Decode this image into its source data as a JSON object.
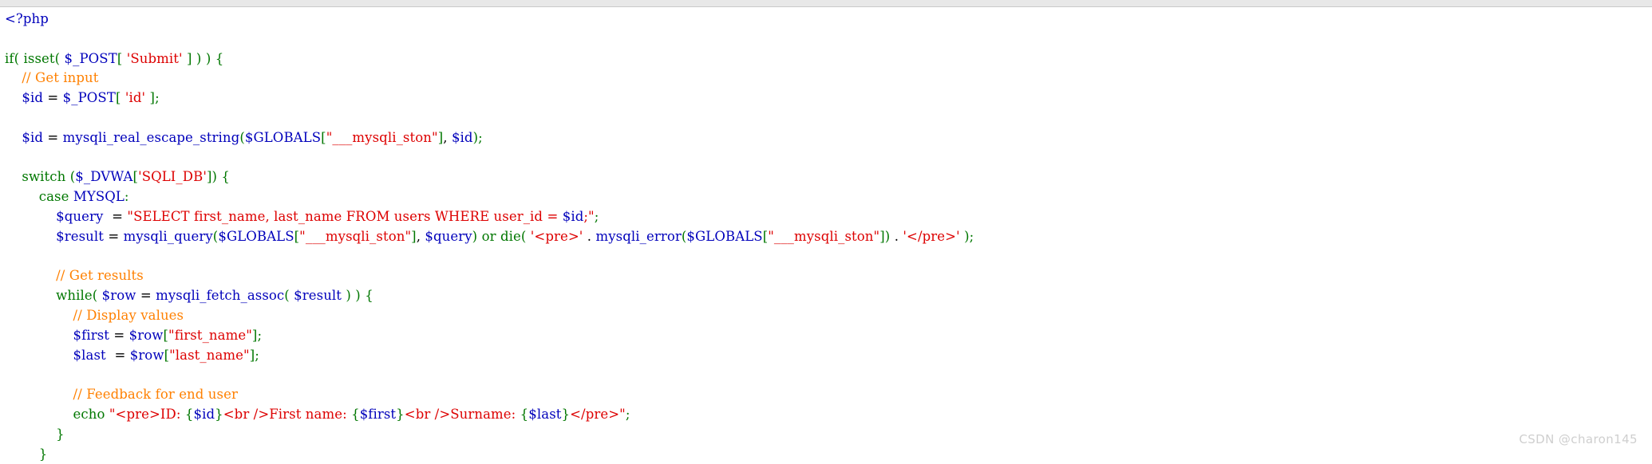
{
  "watermark": {
    "text": "CSDN @charon145",
    "color": "#cfcfcf"
  },
  "colors": {
    "background": "#ffffff",
    "top_rule": "#e8e8e8",
    "tag": "#0000bb",
    "keyword": "#007700",
    "variable": "#0000bb",
    "function": "#0000bb",
    "string": "#dd0000",
    "comment": "#ff8000",
    "punctuation": "#007700",
    "plain": "#000000"
  },
  "code": {
    "language": "php",
    "lines": [
      {
        "index": 0,
        "text": "<?php",
        "tokens": [
          {
            "t": "<?php",
            "c": "tok-tag"
          }
        ]
      },
      {
        "index": 1,
        "text": "",
        "tokens": []
      },
      {
        "index": 2,
        "text": "if( isset( $_POST[ 'Submit' ] ) ) {",
        "tokens": [
          {
            "t": "if",
            "c": "tok-kw"
          },
          {
            "t": "(",
            "c": "tok-punct"
          },
          {
            "t": " ",
            "c": "tok-plain"
          },
          {
            "t": "isset",
            "c": "tok-kw"
          },
          {
            "t": "(",
            "c": "tok-punct"
          },
          {
            "t": " ",
            "c": "tok-plain"
          },
          {
            "t": "$_POST",
            "c": "tok-var"
          },
          {
            "t": "[",
            "c": "tok-punct"
          },
          {
            "t": " ",
            "c": "tok-plain"
          },
          {
            "t": "'Submit'",
            "c": "tok-str"
          },
          {
            "t": " ",
            "c": "tok-plain"
          },
          {
            "t": "]",
            "c": "tok-punct"
          },
          {
            "t": " ",
            "c": "tok-plain"
          },
          {
            "t": ")",
            "c": "tok-punct"
          },
          {
            "t": " ",
            "c": "tok-plain"
          },
          {
            "t": ")",
            "c": "tok-punct"
          },
          {
            "t": " ",
            "c": "tok-plain"
          },
          {
            "t": "{",
            "c": "tok-punct"
          }
        ]
      },
      {
        "index": 3,
        "text": "    // Get input",
        "tokens": [
          {
            "t": "    ",
            "c": "tok-plain"
          },
          {
            "t": "// Get input",
            "c": "tok-comment"
          }
        ]
      },
      {
        "index": 4,
        "text": "    $id = $_POST[ 'id' ];",
        "tokens": [
          {
            "t": "    ",
            "c": "tok-plain"
          },
          {
            "t": "$id",
            "c": "tok-var"
          },
          {
            "t": " = ",
            "c": "tok-plain"
          },
          {
            "t": "$_POST",
            "c": "tok-var"
          },
          {
            "t": "[",
            "c": "tok-punct"
          },
          {
            "t": " ",
            "c": "tok-plain"
          },
          {
            "t": "'id'",
            "c": "tok-str"
          },
          {
            "t": " ",
            "c": "tok-plain"
          },
          {
            "t": "]",
            "c": "tok-punct"
          },
          {
            "t": ";",
            "c": "tok-punct"
          }
        ]
      },
      {
        "index": 5,
        "text": "",
        "tokens": []
      },
      {
        "index": 6,
        "text": "    $id = mysqli_real_escape_string($GLOBALS[\"___mysqli_ston\"], $id);",
        "tokens": [
          {
            "t": "    ",
            "c": "tok-plain"
          },
          {
            "t": "$id",
            "c": "tok-var"
          },
          {
            "t": " = ",
            "c": "tok-plain"
          },
          {
            "t": "mysqli_real_escape_string",
            "c": "tok-fn"
          },
          {
            "t": "(",
            "c": "tok-punct"
          },
          {
            "t": "$GLOBALS",
            "c": "tok-var"
          },
          {
            "t": "[",
            "c": "tok-punct"
          },
          {
            "t": "\"___mysqli_ston\"",
            "c": "tok-str"
          },
          {
            "t": "]",
            "c": "tok-punct"
          },
          {
            "t": ", ",
            "c": "tok-plain"
          },
          {
            "t": "$id",
            "c": "tok-var"
          },
          {
            "t": ")",
            "c": "tok-punct"
          },
          {
            "t": ";",
            "c": "tok-punct"
          }
        ]
      },
      {
        "index": 7,
        "text": "",
        "tokens": []
      },
      {
        "index": 8,
        "text": "    switch ($_DVWA['SQLI_DB']) {",
        "tokens": [
          {
            "t": "    ",
            "c": "tok-plain"
          },
          {
            "t": "switch",
            "c": "tok-kw"
          },
          {
            "t": " ",
            "c": "tok-plain"
          },
          {
            "t": "(",
            "c": "tok-punct"
          },
          {
            "t": "$_DVWA",
            "c": "tok-var"
          },
          {
            "t": "[",
            "c": "tok-punct"
          },
          {
            "t": "'SQLI_DB'",
            "c": "tok-str"
          },
          {
            "t": "]",
            "c": "tok-punct"
          },
          {
            "t": ")",
            "c": "tok-punct"
          },
          {
            "t": " ",
            "c": "tok-plain"
          },
          {
            "t": "{",
            "c": "tok-punct"
          }
        ]
      },
      {
        "index": 9,
        "text": "        case MYSQL:",
        "tokens": [
          {
            "t": "        ",
            "c": "tok-plain"
          },
          {
            "t": "case",
            "c": "tok-kw"
          },
          {
            "t": " ",
            "c": "tok-plain"
          },
          {
            "t": "MYSQL",
            "c": "tok-const"
          },
          {
            "t": ":",
            "c": "tok-punct"
          }
        ]
      },
      {
        "index": 10,
        "text": "            $query  = \"SELECT first_name, last_name FROM users WHERE user_id = $id;\";",
        "tokens": [
          {
            "t": "            ",
            "c": "tok-plain"
          },
          {
            "t": "$query",
            "c": "tok-var"
          },
          {
            "t": "  = ",
            "c": "tok-plain"
          },
          {
            "t": "\"SELECT first_name, last_name FROM users WHERE user_id = ",
            "c": "tok-str"
          },
          {
            "t": "$id",
            "c": "tok-var"
          },
          {
            "t": ";\"",
            "c": "tok-str"
          },
          {
            "t": ";",
            "c": "tok-punct"
          }
        ]
      },
      {
        "index": 11,
        "text": "            $result = mysqli_query($GLOBALS[\"___mysqli_ston\"], $query) or die( '<pre>' . mysqli_error($GLOBALS[\"___mysqli_ston\"]) . '</pre>' );",
        "tokens": [
          {
            "t": "            ",
            "c": "tok-plain"
          },
          {
            "t": "$result",
            "c": "tok-var"
          },
          {
            "t": " = ",
            "c": "tok-plain"
          },
          {
            "t": "mysqli_query",
            "c": "tok-fn"
          },
          {
            "t": "(",
            "c": "tok-punct"
          },
          {
            "t": "$GLOBALS",
            "c": "tok-var"
          },
          {
            "t": "[",
            "c": "tok-punct"
          },
          {
            "t": "\"___mysqli_ston\"",
            "c": "tok-str"
          },
          {
            "t": "]",
            "c": "tok-punct"
          },
          {
            "t": ", ",
            "c": "tok-plain"
          },
          {
            "t": "$query",
            "c": "tok-var"
          },
          {
            "t": ")",
            "c": "tok-punct"
          },
          {
            "t": " ",
            "c": "tok-plain"
          },
          {
            "t": "or",
            "c": "tok-kw"
          },
          {
            "t": " ",
            "c": "tok-plain"
          },
          {
            "t": "die",
            "c": "tok-kw"
          },
          {
            "t": "(",
            "c": "tok-punct"
          },
          {
            "t": " ",
            "c": "tok-plain"
          },
          {
            "t": "'<pre>'",
            "c": "tok-str"
          },
          {
            "t": " ",
            "c": "tok-plain"
          },
          {
            "t": ".",
            "c": "tok-plain"
          },
          {
            "t": " ",
            "c": "tok-plain"
          },
          {
            "t": "mysqli_error",
            "c": "tok-fn"
          },
          {
            "t": "(",
            "c": "tok-punct"
          },
          {
            "t": "$GLOBALS",
            "c": "tok-var"
          },
          {
            "t": "[",
            "c": "tok-punct"
          },
          {
            "t": "\"___mysqli_ston\"",
            "c": "tok-str"
          },
          {
            "t": "]",
            "c": "tok-punct"
          },
          {
            "t": ")",
            "c": "tok-punct"
          },
          {
            "t": " ",
            "c": "tok-plain"
          },
          {
            "t": ".",
            "c": "tok-plain"
          },
          {
            "t": " ",
            "c": "tok-plain"
          },
          {
            "t": "'</pre>'",
            "c": "tok-str"
          },
          {
            "t": " ",
            "c": "tok-plain"
          },
          {
            "t": ")",
            "c": "tok-punct"
          },
          {
            "t": ";",
            "c": "tok-punct"
          }
        ]
      },
      {
        "index": 12,
        "text": "",
        "tokens": []
      },
      {
        "index": 13,
        "text": "            // Get results",
        "tokens": [
          {
            "t": "            ",
            "c": "tok-plain"
          },
          {
            "t": "// Get results",
            "c": "tok-comment"
          }
        ]
      },
      {
        "index": 14,
        "text": "            while( $row = mysqli_fetch_assoc( $result ) ) {",
        "tokens": [
          {
            "t": "            ",
            "c": "tok-plain"
          },
          {
            "t": "while",
            "c": "tok-kw"
          },
          {
            "t": "(",
            "c": "tok-punct"
          },
          {
            "t": " ",
            "c": "tok-plain"
          },
          {
            "t": "$row",
            "c": "tok-var"
          },
          {
            "t": " = ",
            "c": "tok-plain"
          },
          {
            "t": "mysqli_fetch_assoc",
            "c": "tok-fn"
          },
          {
            "t": "(",
            "c": "tok-punct"
          },
          {
            "t": " ",
            "c": "tok-plain"
          },
          {
            "t": "$result",
            "c": "tok-var"
          },
          {
            "t": " ",
            "c": "tok-plain"
          },
          {
            "t": ")",
            "c": "tok-punct"
          },
          {
            "t": " ",
            "c": "tok-plain"
          },
          {
            "t": ")",
            "c": "tok-punct"
          },
          {
            "t": " ",
            "c": "tok-plain"
          },
          {
            "t": "{",
            "c": "tok-punct"
          }
        ]
      },
      {
        "index": 15,
        "text": "                // Display values",
        "tokens": [
          {
            "t": "                ",
            "c": "tok-plain"
          },
          {
            "t": "// Display values",
            "c": "tok-comment"
          }
        ]
      },
      {
        "index": 16,
        "text": "                $first = $row[\"first_name\"];",
        "tokens": [
          {
            "t": "                ",
            "c": "tok-plain"
          },
          {
            "t": "$first",
            "c": "tok-var"
          },
          {
            "t": " = ",
            "c": "tok-plain"
          },
          {
            "t": "$row",
            "c": "tok-var"
          },
          {
            "t": "[",
            "c": "tok-punct"
          },
          {
            "t": "\"first_name\"",
            "c": "tok-str"
          },
          {
            "t": "]",
            "c": "tok-punct"
          },
          {
            "t": ";",
            "c": "tok-punct"
          }
        ]
      },
      {
        "index": 17,
        "text": "                $last  = $row[\"last_name\"];",
        "tokens": [
          {
            "t": "                ",
            "c": "tok-plain"
          },
          {
            "t": "$last",
            "c": "tok-var"
          },
          {
            "t": "  = ",
            "c": "tok-plain"
          },
          {
            "t": "$row",
            "c": "tok-var"
          },
          {
            "t": "[",
            "c": "tok-punct"
          },
          {
            "t": "\"last_name\"",
            "c": "tok-str"
          },
          {
            "t": "]",
            "c": "tok-punct"
          },
          {
            "t": ";",
            "c": "tok-punct"
          }
        ]
      },
      {
        "index": 18,
        "text": "",
        "tokens": []
      },
      {
        "index": 19,
        "text": "                // Feedback for end user",
        "tokens": [
          {
            "t": "                ",
            "c": "tok-plain"
          },
          {
            "t": "// Feedback for end user",
            "c": "tok-comment"
          }
        ]
      },
      {
        "index": 20,
        "text": "                echo \"<pre>ID: {$id}<br />First name: {$first}<br />Surname: {$last}</pre>\";",
        "tokens": [
          {
            "t": "                ",
            "c": "tok-plain"
          },
          {
            "t": "echo",
            "c": "tok-kw"
          },
          {
            "t": " ",
            "c": "tok-plain"
          },
          {
            "t": "\"<pre>ID: ",
            "c": "tok-str"
          },
          {
            "t": "{",
            "c": "tok-punct"
          },
          {
            "t": "$id",
            "c": "tok-var"
          },
          {
            "t": "}",
            "c": "tok-punct"
          },
          {
            "t": "<br />First name: ",
            "c": "tok-str"
          },
          {
            "t": "{",
            "c": "tok-punct"
          },
          {
            "t": "$first",
            "c": "tok-var"
          },
          {
            "t": "}",
            "c": "tok-punct"
          },
          {
            "t": "<br />Surname: ",
            "c": "tok-str"
          },
          {
            "t": "{",
            "c": "tok-punct"
          },
          {
            "t": "$last",
            "c": "tok-var"
          },
          {
            "t": "}",
            "c": "tok-punct"
          },
          {
            "t": "</pre>\"",
            "c": "tok-str"
          },
          {
            "t": ";",
            "c": "tok-punct"
          }
        ]
      },
      {
        "index": 21,
        "text": "            }",
        "tokens": [
          {
            "t": "            ",
            "c": "tok-plain"
          },
          {
            "t": "}",
            "c": "tok-punct"
          }
        ]
      },
      {
        "index": 22,
        "text": "        }",
        "tokens": [
          {
            "t": "        ",
            "c": "tok-plain"
          },
          {
            "t": "}",
            "c": "tok-punct"
          }
        ]
      }
    ]
  }
}
